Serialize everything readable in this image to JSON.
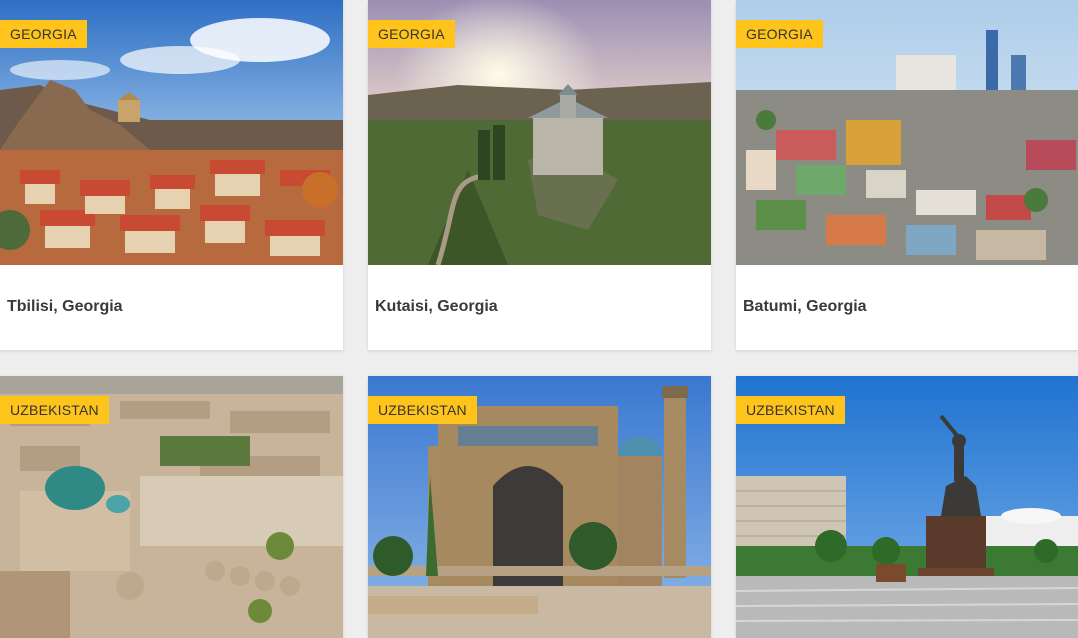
{
  "cards": [
    {
      "badge": "GEORGIA",
      "title": "Tbilisi, Georgia",
      "image": "tbilisi-old-town-photo"
    },
    {
      "badge": "GEORGIA",
      "title": "Kutaisi, Georgia",
      "image": "bagrati-cathedral-photo"
    },
    {
      "badge": "GEORGIA",
      "title": "Batumi, Georgia",
      "image": "batumi-cityscape-photo"
    },
    {
      "badge": "UZBEKISTAN",
      "title": "",
      "image": "khiva-old-city-photo"
    },
    {
      "badge": "UZBEKISTAN",
      "title": "",
      "image": "registan-madrasa-photo"
    },
    {
      "badge": "UZBEKISTAN",
      "title": "",
      "image": "amir-timur-square-photo"
    }
  ],
  "colors": {
    "badge_bg": "#ffc41c",
    "page_bg": "#eeeeee",
    "card_bg": "#ffffff",
    "caption_text": "#3a3a3a"
  }
}
